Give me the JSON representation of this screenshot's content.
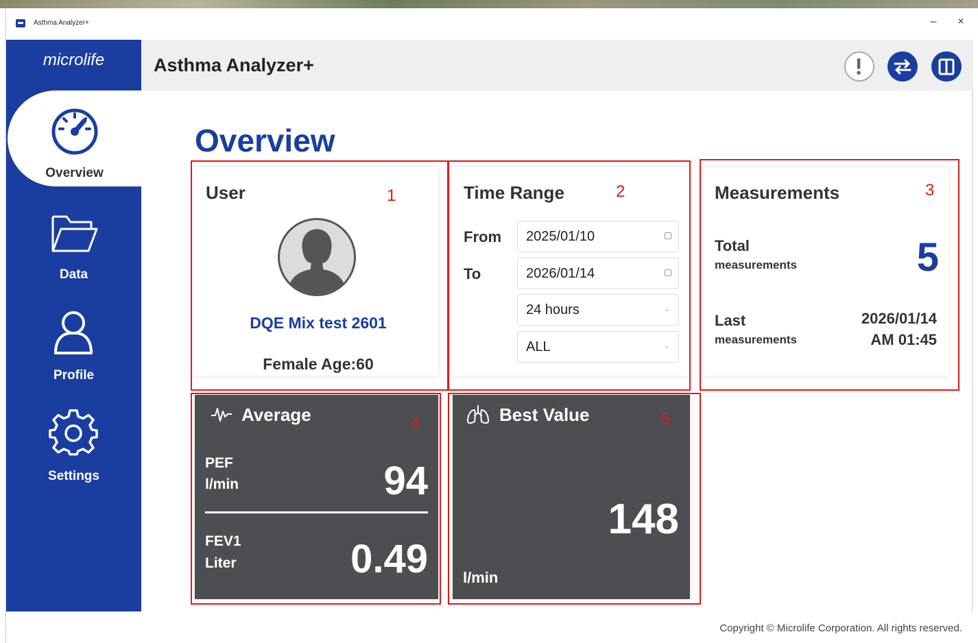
{
  "window": {
    "title": "Asthma Analyzer+",
    "minimize": "–",
    "close": "×"
  },
  "sidebar": {
    "logo": "microlife",
    "items": [
      {
        "label": "Overview",
        "icon": "speedometer-icon",
        "active": true
      },
      {
        "label": "Data",
        "icon": "folder-icon"
      },
      {
        "label": "Profile",
        "icon": "person-icon"
      },
      {
        "label": "Settings",
        "icon": "gear-icon"
      }
    ]
  },
  "header": {
    "title": "Asthma Analyzer+",
    "buttons": [
      {
        "icon": "alert-icon",
        "glyph": "!"
      },
      {
        "icon": "sync-arrows-icon",
        "glyph": "⇄"
      },
      {
        "icon": "book-icon",
        "glyph": ""
      }
    ]
  },
  "page": {
    "title": "Overview"
  },
  "user_card": {
    "title": "User",
    "name": "DQE Mix test 2601",
    "info": "Female Age:60"
  },
  "time_range": {
    "title": "Time Range",
    "from_label": "From",
    "to_label": "To",
    "from_value": "2025/01/10",
    "to_value": "2026/01/14",
    "interval": "24 hours",
    "filter": "ALL"
  },
  "measurements": {
    "title": "Measurements",
    "total_label": "Total",
    "total_sub": "measurements",
    "total_value": "5",
    "last_label": "Last",
    "last_sub": "measurements",
    "last_date": "2026/01/14",
    "last_time": "AM 01:45"
  },
  "average": {
    "title": "Average",
    "pef_label": "PEF",
    "pef_unit": "l/min",
    "pef_value": "94",
    "fev1_label": "FEV1",
    "fev1_unit": "Liter",
    "fev1_value": "0.49"
  },
  "best_value": {
    "title": "Best Value",
    "value": "148",
    "unit": "l/min"
  },
  "annotations": [
    "1",
    "2",
    "3",
    "4",
    "5"
  ],
  "footer": {
    "copyright": "Copyright © Microlife Corporation. All rights reserved."
  },
  "colors": {
    "brand": "#1a3ea0",
    "dark_card": "#4d4e52",
    "annotation": "#e31919"
  }
}
